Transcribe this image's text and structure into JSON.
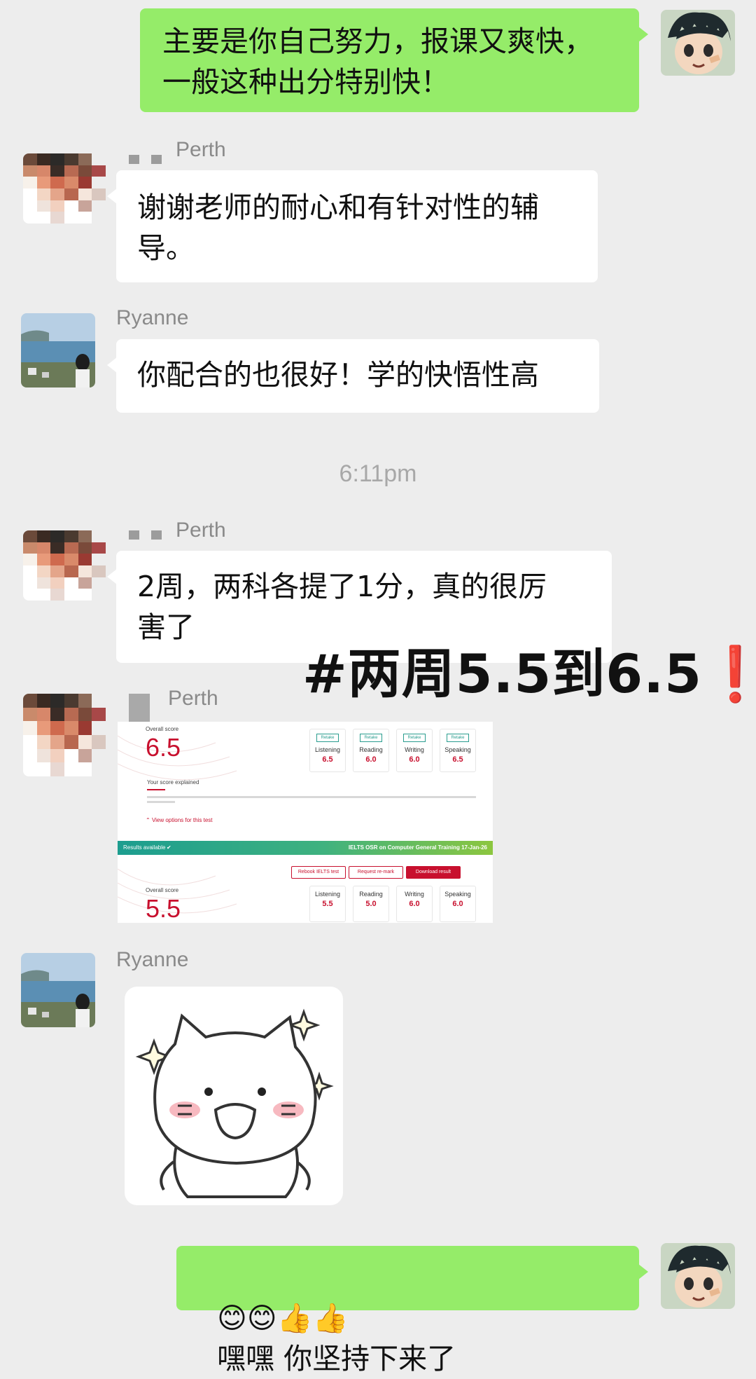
{
  "messages": {
    "m1_text": "主要是你自己努力，报课又爽快，\n一般这种出分特别快！",
    "m2_sender": "Perth",
    "m2_text": "谢谢老师的耐心和有针对性的辅\n导。",
    "m3_sender": "Ryanne",
    "m3_text": "你配合的也很好！学的快悟性高",
    "timestamp": "6:11pm",
    "m4_sender": "Perth",
    "m4_text": "2周，两科各提了1分，真的很厉\n害了",
    "m5_sender": "Perth",
    "m6_sender": "Ryanne",
    "m7_emojis": "😊😊👍👍",
    "m7_text": "嘿嘿 你坚持下来了"
  },
  "overlay": {
    "text": "#两周5.5到6.5",
    "mark": "❗"
  },
  "screenshot": {
    "top_overall_label": "Overall score",
    "top_overall_value": "6.5",
    "score_explained": "Your score explained",
    "view_options": "View options for this test",
    "top_scores": [
      {
        "name": "Listening",
        "value": "6.5",
        "retake": "Retake"
      },
      {
        "name": "Reading",
        "value": "6.0",
        "retake": "Retake"
      },
      {
        "name": "Writing",
        "value": "6.0",
        "retake": "Retake"
      },
      {
        "name": "Speaking",
        "value": "6.5",
        "retake": "Retake"
      }
    ],
    "results_available": "Results available",
    "test_title": "IELTS OSR on Computer General Training 17-Jan-26",
    "btn_rebook": "Rebook IELTS test",
    "btn_remark": "Request re-mark",
    "btn_download": "Download result",
    "bottom_overall_label": "Overall score",
    "bottom_overall_value": "5.5",
    "bottom_scores": [
      {
        "name": "Listening",
        "value": "5.5"
      },
      {
        "name": "Reading",
        "value": "5.0"
      },
      {
        "name": "Writing",
        "value": "6.0"
      },
      {
        "name": "Speaking",
        "value": "6.0"
      }
    ]
  }
}
